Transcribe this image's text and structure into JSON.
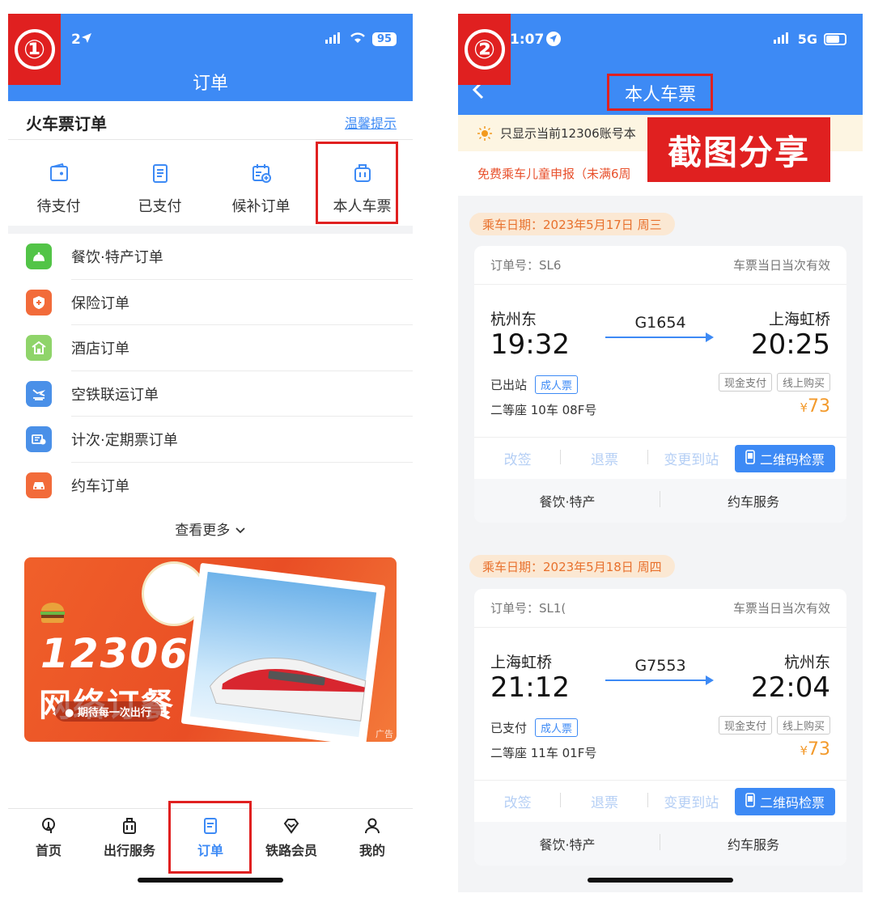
{
  "phone1": {
    "marker": "①",
    "status_time": "2",
    "battery": "95",
    "nav_title": "订单",
    "section_title": "火车票订单",
    "tips_link": "温馨提示",
    "quick_actions": [
      {
        "label": "待支付",
        "icon": "wallet-icon"
      },
      {
        "label": "已支付",
        "icon": "receipt-icon"
      },
      {
        "label": "候补订单",
        "icon": "calendar-add-icon"
      },
      {
        "label": "本人车票",
        "icon": "suitcase-icon"
      }
    ],
    "orders": [
      {
        "label": "餐饮·特产订单",
        "icon": "food-icon",
        "color": "#52c447"
      },
      {
        "label": "保险订单",
        "icon": "shield-icon",
        "color": "#f26b3a"
      },
      {
        "label": "酒店订单",
        "icon": "hotel-icon",
        "color": "#8fd46a"
      },
      {
        "label": "空铁联运订单",
        "icon": "air-rail-icon",
        "color": "#4a90e8"
      },
      {
        "label": "计次·定期票订单",
        "icon": "ticket-pass-icon",
        "color": "#4a90e8"
      },
      {
        "label": "约车订单",
        "icon": "car-icon",
        "color": "#f26b3a"
      }
    ],
    "more_label": "查看更多",
    "banner": {
      "big_text": "12306",
      "sub_text": "网络订餐",
      "pill_text": "● 期待每一次出行",
      "ad_label": "广告"
    },
    "tabs": [
      {
        "label": "首页",
        "icon": "home-icon"
      },
      {
        "label": "出行服务",
        "icon": "luggage-icon"
      },
      {
        "label": "订单",
        "icon": "order-icon"
      },
      {
        "label": "铁路会员",
        "icon": "member-icon"
      },
      {
        "label": "我的",
        "icon": "person-icon"
      }
    ]
  },
  "phone2": {
    "marker": "②",
    "status_time": "1:07",
    "network": "5G",
    "nav_title": "本人车票",
    "notice": "只显示当前12306账号本",
    "child_notice": "免费乘车儿童申报（未满6周",
    "share_overlay": "截图分享",
    "trips": [
      {
        "date": "乘车日期：2023年5月17日 周三",
        "order_no": "订单号：SL6",
        "validity": "车票当日当次有效",
        "from": "杭州东",
        "to": "上海虹桥",
        "train": "G1654",
        "dep_time": "19:32",
        "arr_time": "20:25",
        "status": "已出站",
        "ticket_type": "成人票",
        "tag_pay": "现金支付",
        "tag_buy": "线上购买",
        "seat": "二等座 10车 08F号",
        "currency": "¥",
        "price": "73",
        "actions": [
          "改签",
          "退票",
          "变更到站"
        ],
        "qr_label": "二维码检票",
        "services": [
          "餐饮·特产",
          "约车服务"
        ]
      },
      {
        "date": "乘车日期：2023年5月18日 周四",
        "order_no": "订单号：SL1(",
        "validity": "车票当日当次有效",
        "from": "上海虹桥",
        "to": "杭州东",
        "train": "G7553",
        "dep_time": "21:12",
        "arr_time": "22:04",
        "status": "已支付",
        "ticket_type": "成人票",
        "tag_pay": "现金支付",
        "tag_buy": "线上购买",
        "seat": "二等座 11车 01F号",
        "currency": "¥",
        "price": "73",
        "actions": [
          "改签",
          "退票",
          "变更到站"
        ],
        "qr_label": "二维码检票",
        "services": [
          "餐饮·特产",
          "约车服务"
        ]
      }
    ]
  },
  "colors": {
    "primary": "#3d8af5",
    "highlight": "#e02020",
    "price": "#f39a2c",
    "warning": "#e8502c"
  }
}
